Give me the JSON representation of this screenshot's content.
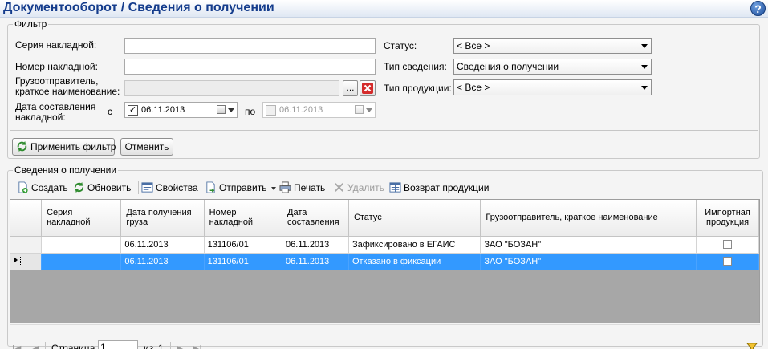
{
  "window": {
    "title": "Документооборот  / Сведения о получении"
  },
  "filter": {
    "legend": "Фильтр",
    "series_label": "Серия накладной:",
    "series_value": "",
    "number_label": "Номер накладной:",
    "number_value": "",
    "shipper_label_line1": "Грузоотправитель,",
    "shipper_label_line2": "краткое наименование:",
    "shipper_value": "",
    "browse_glyph": "...",
    "date_label_line1": "Дата составления",
    "date_label_line2": "накладной:",
    "date_from_label": "с",
    "date_from_value": "06.11.2013",
    "date_from_checked": true,
    "date_to_label": "по",
    "date_to_value": "06.11.2013",
    "date_to_checked": false,
    "status_label": "Статус:",
    "status_value": "< Все >",
    "info_type_label": "Тип сведения:",
    "info_type_value": "Сведения о получении",
    "product_type_label": "Тип продукции:",
    "product_type_value": "< Все >",
    "apply_label": "Применить фильтр",
    "cancel_label": "Отменить"
  },
  "list": {
    "legend": "Сведения о получении",
    "toolbar": {
      "create": "Создать",
      "refresh": "Обновить",
      "properties": "Свойства",
      "send": "Отправить",
      "print": "Печать",
      "delete": "Удалить",
      "return": "Возврат продукции"
    },
    "columns": [
      {
        "label": "Серия накладной"
      },
      {
        "label": "Дата получения груза"
      },
      {
        "label": "Номер накладной"
      },
      {
        "label": "Дата составления"
      },
      {
        "label": "Статус"
      },
      {
        "label": "Грузоотправитель, краткое наименование"
      },
      {
        "label": "Импортная продукция"
      }
    ],
    "rows": [
      {
        "series": "",
        "received": "06.11.2013",
        "number": "131106/01",
        "composed": "06.11.2013",
        "status": "Зафиксировано в ЕГАИС",
        "shipper": "ЗАО \"БОЗАН\"",
        "imported": false,
        "selected": false
      },
      {
        "series": "",
        "received": "06.11.2013",
        "number": "131106/01",
        "composed": "06.11.2013",
        "status": "Отказано в фиксации",
        "shipper": "ЗАО \"БОЗАН\"",
        "imported": false,
        "selected": true
      }
    ]
  },
  "pager": {
    "page_label": "Страница",
    "page_value": "1",
    "of_label": "из",
    "total": "1"
  },
  "colors": {
    "title": "#143c8c",
    "selection": "#3399ff",
    "delete_red": "#d42a2a"
  },
  "icons": [
    "help-icon",
    "clear-icon",
    "calendar-icon",
    "create-icon",
    "refresh-icon",
    "properties-icon",
    "send-icon",
    "print-icon",
    "delete-icon",
    "return-icon",
    "apply-filter-icon",
    "first-page-icon",
    "prev-page-icon",
    "next-page-icon",
    "last-page-icon",
    "filter-settings-icon",
    "row-indicator-icon"
  ]
}
